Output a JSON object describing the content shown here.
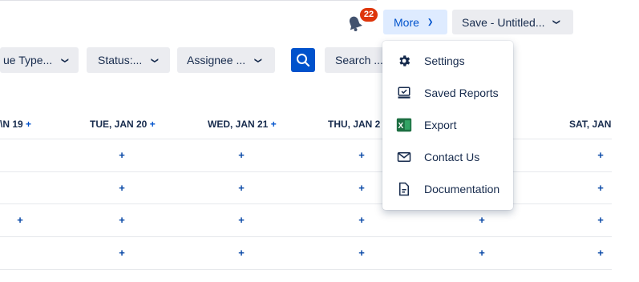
{
  "header": {
    "notification_count": "22",
    "more_label": "More",
    "save_label": "Save - Untitled..."
  },
  "filters": {
    "issue_type": "ue Type...",
    "status": "Status:...",
    "assignee": "Assignee ...",
    "search_label": "Search ..."
  },
  "calendar": {
    "days": [
      {
        "label": "\\N 19",
        "plus": "+"
      },
      {
        "label": "TUE, JAN 20",
        "plus": "+"
      },
      {
        "label": "WED, JAN 21",
        "plus": "+"
      },
      {
        "label": "THU, JAN 2",
        "plus": ""
      },
      {
        "label": "SAT, JAN",
        "plus": ""
      }
    ],
    "add_symbol": "+"
  },
  "menu": {
    "items": [
      {
        "label": "Settings",
        "icon": "gear-icon"
      },
      {
        "label": "Saved Reports",
        "icon": "saved-reports-icon"
      },
      {
        "label": "Export",
        "icon": "excel-icon"
      },
      {
        "label": "Contact Us",
        "icon": "mail-icon"
      },
      {
        "label": "Documentation",
        "icon": "document-icon"
      }
    ]
  },
  "colors": {
    "accent": "#0052cc",
    "badge": "#de350b",
    "excel_green": "#1d6f42"
  }
}
